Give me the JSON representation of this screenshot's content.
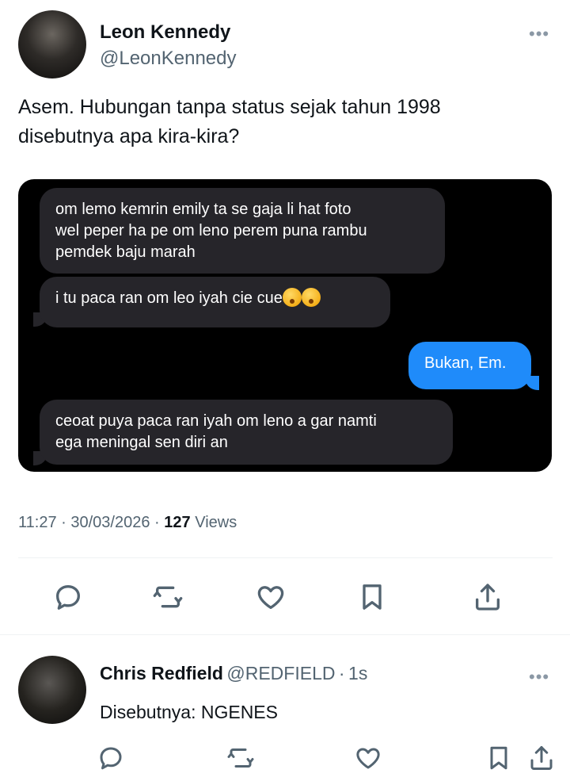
{
  "tweet": {
    "author_name": "Leon Kennedy",
    "author_handle": "@LeonKennedy",
    "more_label": "•••",
    "text_line1": "Asem. Hubungan tanpa status sejak tahun 1998",
    "text_line2": "disebutnya apa kira-kira?",
    "chat": {
      "msg1": "om lemo kemrin emily ta se gaja li hat foto\nwel peper ha pe om leno perem puna rambu\npemdek baju marah",
      "msg2": "i tu paca ran om leo iyah cie cue",
      "msg2_emojis": [
        "face-with-hand-over-mouth",
        "hushed-face"
      ],
      "msg3": "Bukan, Em.",
      "msg4": "ceoat puya paca ran iyah om leno a gar namti\nega meningal sen diri an"
    },
    "time": "11:27",
    "sep": "·",
    "date": "30/03/2026",
    "views_count": "127",
    "views_label": "Views",
    "actions": [
      "reply-icon",
      "retweet-icon",
      "like-icon",
      "bookmark-icon",
      "share-icon"
    ]
  },
  "reply": {
    "author_name": "Chris Redfield",
    "author_handle": "@REDFIELD",
    "sep": "·",
    "time_ago": "1s",
    "text": "Disebutnya: NGENES",
    "more_label": "•••"
  },
  "colors": {
    "text": "#0f1419",
    "secondary": "#536471",
    "bubble_gray": "#26252a",
    "bubble_blue": "#1f8bfa",
    "divider": "#eff3f4"
  }
}
